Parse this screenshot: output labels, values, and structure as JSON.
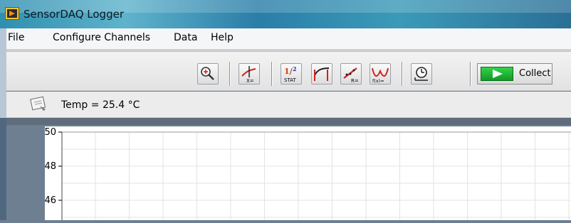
{
  "window": {
    "title": "SensorDAQ Logger"
  },
  "menu": {
    "items": [
      "File",
      "Configure Channels",
      "Data",
      "Help"
    ]
  },
  "toolbar": {
    "buttons": [
      {
        "icon": "zoom-in-icon"
      },
      {
        "icon": "examine-icon",
        "caption": "X="
      },
      {
        "icon": "statistics-icon",
        "caption": "STAT"
      },
      {
        "icon": "integral-icon"
      },
      {
        "icon": "linear-fit-icon",
        "caption": "R="
      },
      {
        "icon": "curve-fit-icon",
        "caption": "f(x)="
      },
      {
        "icon": "data-collection-settings-icon"
      }
    ],
    "collect_label": "Collect"
  },
  "status": {
    "reading": "Temp = 25.4 °C"
  },
  "chart_data": {
    "type": "line",
    "ylim": [
      44.5,
      50.5
    ],
    "yticks": [
      "50",
      "48",
      "46"
    ],
    "grid": true,
    "series": []
  },
  "colors": {
    "accent_green": "#1fb832",
    "grid": "#e3e3e3",
    "frame_bg": "#6f7f92"
  }
}
